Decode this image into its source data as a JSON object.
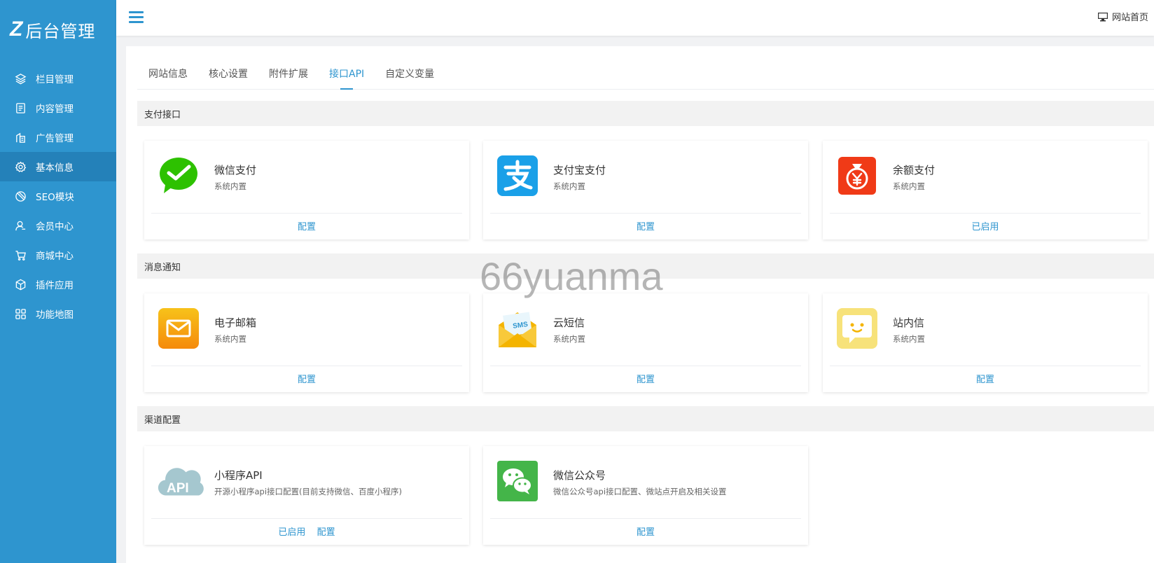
{
  "logo": {
    "mark": "Z",
    "text": "后台管理"
  },
  "sidebar": {
    "items": [
      {
        "label": "栏目管理",
        "icon": "layers-icon"
      },
      {
        "label": "内容管理",
        "icon": "document-icon"
      },
      {
        "label": "广告管理",
        "icon": "ad-icon"
      },
      {
        "label": "基本信息",
        "icon": "gear-icon",
        "active": true
      },
      {
        "label": "SEO模块",
        "icon": "seo-icon"
      },
      {
        "label": "会员中心",
        "icon": "user-icon"
      },
      {
        "label": "商城中心",
        "icon": "cart-icon"
      },
      {
        "label": "插件应用",
        "icon": "cube-icon"
      },
      {
        "label": "功能地图",
        "icon": "grid-icon"
      }
    ]
  },
  "topbar": {
    "site_home": "网站首页"
  },
  "tabs": [
    {
      "label": "网站信息"
    },
    {
      "label": "核心设置"
    },
    {
      "label": "附件扩展"
    },
    {
      "label": "接口API",
      "active": true
    },
    {
      "label": "自定义变量"
    }
  ],
  "sections": [
    {
      "title": "支付接口",
      "cards": [
        {
          "icon": "wechat-pay-icon",
          "title": "微信支付",
          "desc": "系统内置",
          "actions": [
            "配置"
          ]
        },
        {
          "icon": "alipay-icon",
          "title": "支付宝支付",
          "desc": "系统内置",
          "actions": [
            "配置"
          ]
        },
        {
          "icon": "balance-pay-icon",
          "title": "余额支付",
          "desc": "系统内置",
          "actions": [
            "已启用"
          ]
        }
      ]
    },
    {
      "title": "消息通知",
      "cards": [
        {
          "icon": "email-icon",
          "title": "电子邮箱",
          "desc": "系统内置",
          "actions": [
            "配置"
          ]
        },
        {
          "icon": "sms-icon",
          "title": "云短信",
          "desc": "系统内置",
          "actions": [
            "配置"
          ]
        },
        {
          "icon": "site-message-icon",
          "title": "站内信",
          "desc": "系统内置",
          "actions": [
            "配置"
          ]
        }
      ]
    },
    {
      "title": "渠道配置",
      "cards": [
        {
          "icon": "api-cloud-icon",
          "title": "小程序API",
          "desc": "开源小程序api接口配置(目前支持微信、百度小程序)",
          "actions": [
            "已启用",
            "配置"
          ]
        },
        {
          "icon": "wechat-official-icon",
          "title": "微信公众号",
          "desc": "微信公众号api接口配置、微站点开启及相关设置",
          "actions": [
            "配置"
          ]
        }
      ]
    }
  ],
  "watermark": "66yuanma",
  "colors": {
    "sidebar": "#2e95cf",
    "sidebar_active": "#2481b9",
    "accent": "#2e95cf"
  }
}
